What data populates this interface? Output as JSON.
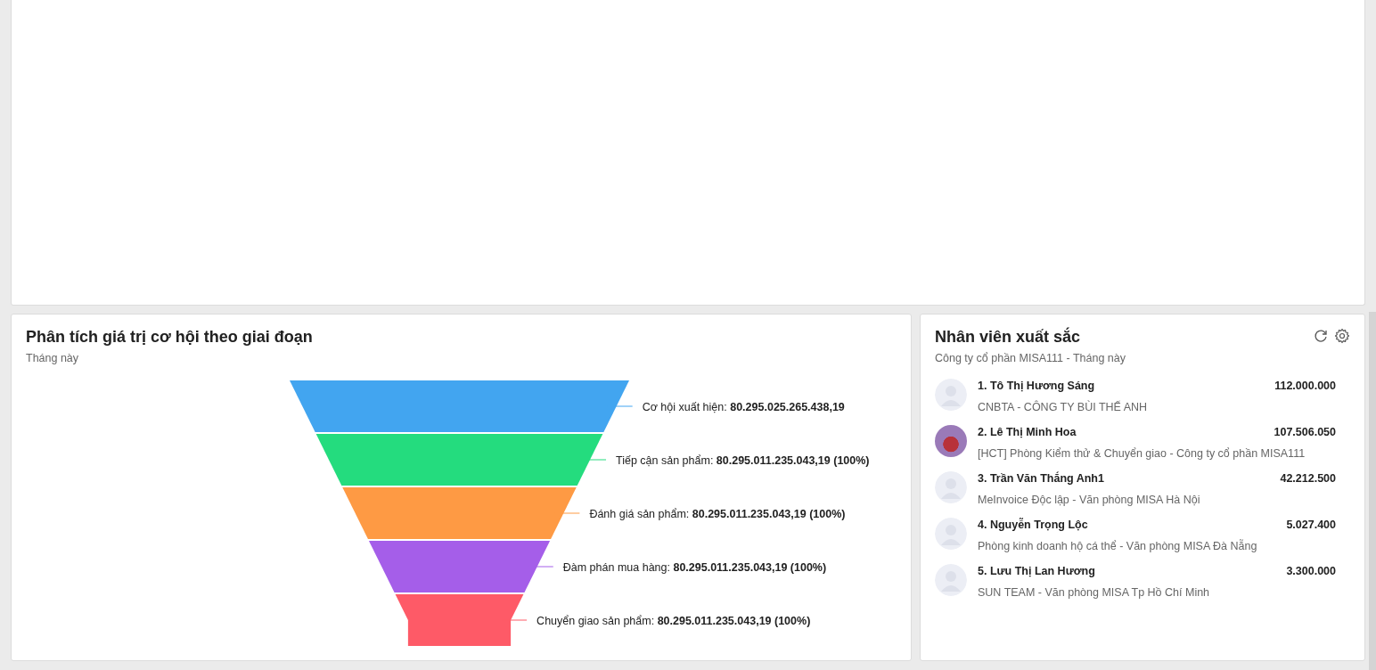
{
  "funnel_card": {
    "title": "Phân tích giá trị cơ hội theo giai đoạn",
    "subtitle": "Tháng này",
    "stages": [
      {
        "label": "Cơ hội xuất hiện:",
        "value": "80.295.025.265.438,19",
        "color": "#42a5f0"
      },
      {
        "label": "Tiếp cận sản phẩm:",
        "value": "80.295.011.235.043,19 (100%)",
        "color": "#24dc7e"
      },
      {
        "label": "Đánh giá sản phẩm:",
        "value": "80.295.011.235.043,19 (100%)",
        "color": "#fe9a44"
      },
      {
        "label": "Đàm phán mua hàng:",
        "value": "80.295.011.235.043,19 (100%)",
        "color": "#a55ee9"
      },
      {
        "label": "Chuyển giao sản phẩm:",
        "value": "80.295.011.235.043,19 (100%)",
        "color": "#fe5a67"
      }
    ]
  },
  "staff_card": {
    "title": "Nhân viên xuất sắc",
    "subtitle": "Công ty cổ phần MISA111 - Tháng này",
    "staff": [
      {
        "name": "1. Tô Thị Hương Sáng",
        "amount": "112.000.000",
        "unit": "CNBTA - CÔNG TY BÙI THẾ ANH",
        "kind": "default"
      },
      {
        "name": "2. Lê Thị Minh Hoa",
        "amount": "107.506.050",
        "unit": "[HCT] Phòng Kiểm thử & Chuyển giao - Công ty cổ phần MISA111",
        "kind": "photo"
      },
      {
        "name": "3. Trần Văn Thắng Anh1",
        "amount": "42.212.500",
        "unit": "MeInvoice Độc lập - Văn phòng MISA Hà Nội",
        "kind": "default"
      },
      {
        "name": "4. Nguyễn Trọng Lộc",
        "amount": "5.027.400",
        "unit": "Phòng kinh doanh hộ cá thể - Văn phòng MISA Đà Nẵng",
        "kind": "default"
      },
      {
        "name": "5. Lưu Thị Lan Hương",
        "amount": "3.300.000",
        "unit": "SUN TEAM - Văn phòng MISA Tp Hồ Chí Minh",
        "kind": "default"
      }
    ]
  }
}
